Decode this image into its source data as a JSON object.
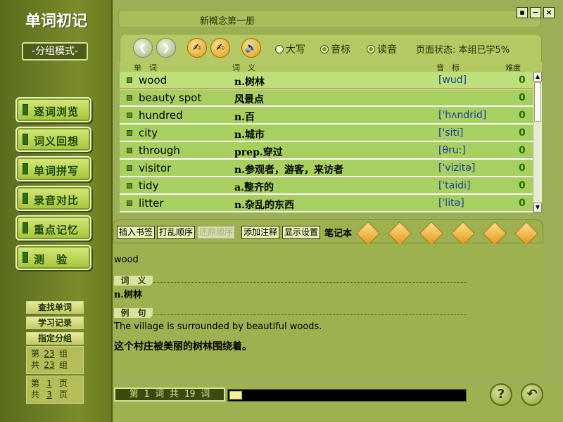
{
  "sidebar": {
    "app_title": "单词初记",
    "mode_label": "-分组模式-",
    "nav": [
      {
        "label": "逐词浏览"
      },
      {
        "label": "词义回想"
      },
      {
        "label": "单词拼写"
      },
      {
        "label": "录音对比"
      },
      {
        "label": "重点记忆"
      },
      {
        "label": "测　验"
      }
    ],
    "find_word": "查找单词",
    "study_record": "学习记录",
    "assign_group": "指定分组",
    "group_info": {
      "cur_prefix": "第",
      "cur": "23",
      "cur_suffix": "组",
      "tot_prefix": "共",
      "tot": "23",
      "tot_suffix": "组"
    },
    "page_info": {
      "cur_prefix": "第",
      "cur": "1",
      "cur_suffix": "页",
      "tot_prefix": "共",
      "tot": "3",
      "tot_suffix": "页"
    }
  },
  "window": {
    "title": "新概念第一册",
    "minimize_btn": "▪",
    "restore_btn": "−",
    "close_btn": "×"
  },
  "toolbar": {
    "radio_uppercase": "大写",
    "radio_phonetic": "音标",
    "radio_read": "读音",
    "uppercase_checked": false,
    "phonetic_checked": true,
    "read_checked": true,
    "page_status": "页面状态: 本组已学5%"
  },
  "columns": {
    "word": "单　词",
    "meaning": "词　义",
    "phonetic": "音　标",
    "difficulty": "难度"
  },
  "words": [
    {
      "word": "wood",
      "meaning": "n.树林",
      "phonetic": "[wud]",
      "difficulty": "0"
    },
    {
      "word": "beauty spot",
      "meaning": "风景点",
      "phonetic": "",
      "difficulty": "0"
    },
    {
      "word": "hundred",
      "meaning": "n.百",
      "phonetic": "['hʌndrid]",
      "difficulty": "0"
    },
    {
      "word": "city",
      "meaning": "n.城市",
      "phonetic": "['siti]",
      "difficulty": "0"
    },
    {
      "word": "through",
      "meaning": "prep.穿过",
      "phonetic": "[θru:]",
      "difficulty": "0"
    },
    {
      "word": "visitor",
      "meaning": "n.参观者，游客，来访者",
      "phonetic": "['vizitə]",
      "difficulty": "0"
    },
    {
      "word": "tidy",
      "meaning": "a.整齐的",
      "phonetic": "['taidi]",
      "difficulty": "0"
    },
    {
      "word": "litter",
      "meaning": "n.杂乱的东西",
      "phonetic": "['litə]",
      "difficulty": "0"
    }
  ],
  "notes_toolbar": {
    "bookmark": "插入书签",
    "shuffle": "打乱顺序",
    "restore": "还原顺序",
    "add_note": "添加注释",
    "display_settings": "显示设置",
    "notebook": "笔记本"
  },
  "detail": {
    "word": "wood",
    "meaning_header": "词　义",
    "meaning": "n.树林",
    "example_header": "例　句",
    "example_en": "The village is surrounded by beautiful woods.",
    "example_cn": "这个村庄被美丽的树林围绕着。"
  },
  "footer": {
    "counter": "第 1 词  共 19 词",
    "progress_fraction": 0.053,
    "help_icon": "?",
    "back_icon": "↶"
  },
  "colors": {
    "accent": "#a7d061",
    "selected_row": "#bde07a",
    "phonetic": "#1a3a9c",
    "difficulty": "#1f6e12"
  }
}
